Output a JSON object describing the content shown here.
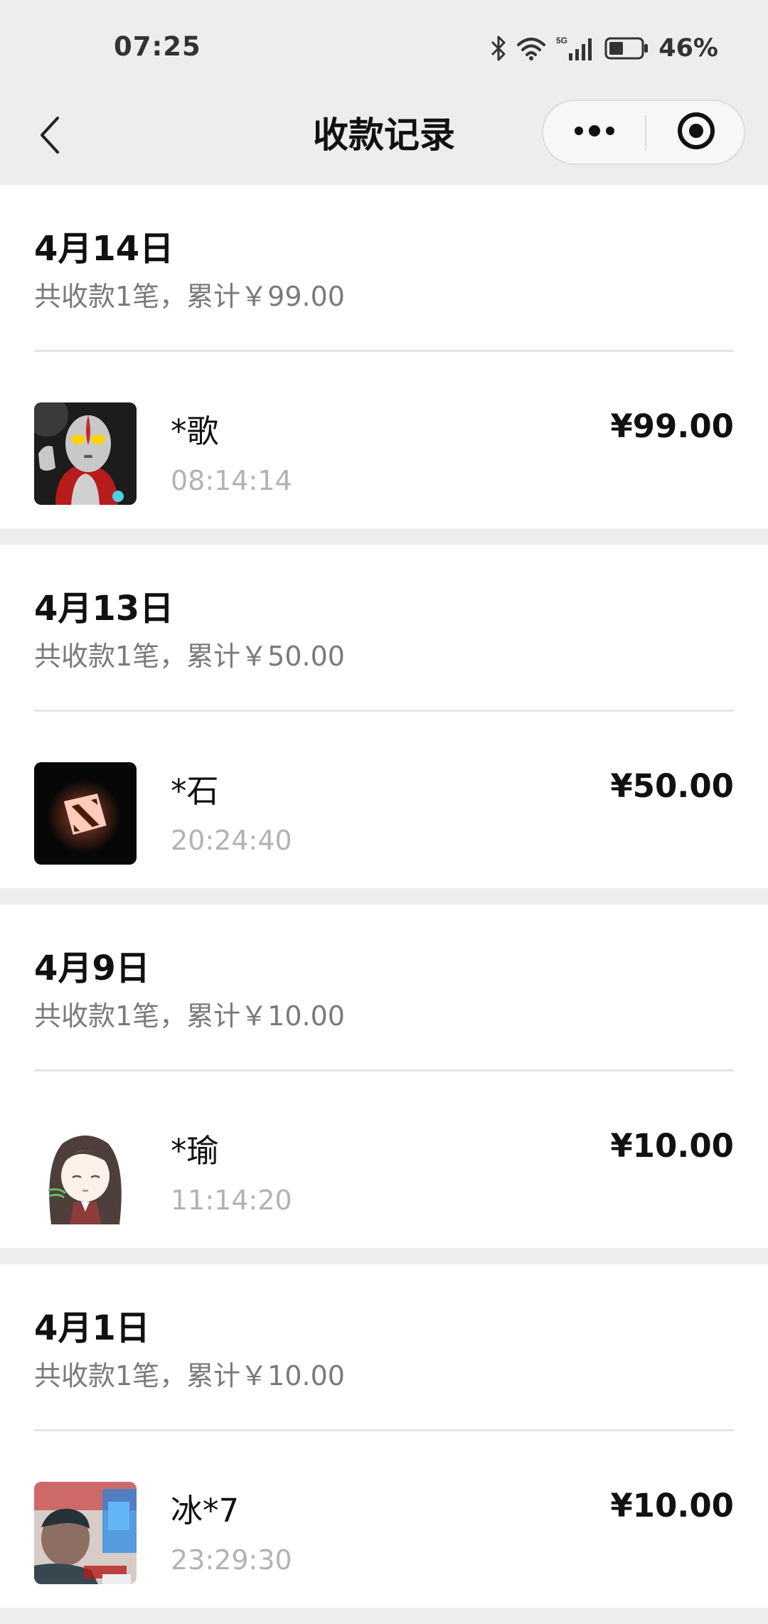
{
  "status_bar": {
    "time": "07:25",
    "battery_percent": "46%",
    "battery_level": 0.46,
    "icons": [
      "bluetooth-icon",
      "wifi-icon",
      "5g-signal-icon",
      "battery-icon"
    ]
  },
  "nav": {
    "title": "收款记录",
    "back_icon": "chevron-left-icon",
    "more_icon": "more-dots-icon",
    "close_icon": "target-close-icon"
  },
  "days": [
    {
      "date": "4月14日",
      "summary": "共收款1笔，累计￥99.00",
      "records": [
        {
          "name": "*歌",
          "time": "08:14:14",
          "amount": "¥99.00",
          "avatar": "ultraman-avatar"
        }
      ]
    },
    {
      "date": "4月13日",
      "summary": "共收款1笔，累计￥50.00",
      "records": [
        {
          "name": "*石",
          "time": "20:24:40",
          "amount": "¥50.00",
          "avatar": "dota-logo-avatar"
        }
      ]
    },
    {
      "date": "4月9日",
      "summary": "共收款1笔，累计￥10.00",
      "records": [
        {
          "name": "*瑜",
          "time": "11:14:20",
          "amount": "¥10.00",
          "avatar": "anime-girl-avatar"
        }
      ]
    },
    {
      "date": "4月1日",
      "summary": "共收款1笔，累计￥10.00",
      "records": [
        {
          "name": "冰*7",
          "time": "23:29:30",
          "amount": "¥10.00",
          "avatar": "photo-person-avatar"
        }
      ]
    }
  ],
  "colors": {
    "background": "#ededed",
    "card": "#ffffff",
    "primary_text": "#111111",
    "secondary_text": "#7a7a7a",
    "time_text": "#b2b2b2",
    "divider": "#e5e5e5"
  }
}
